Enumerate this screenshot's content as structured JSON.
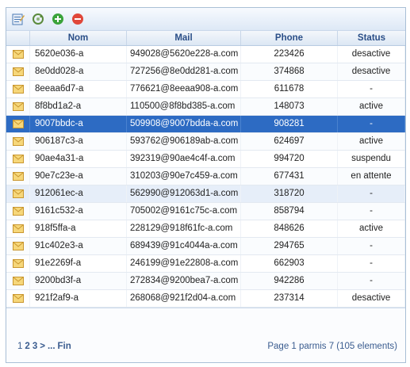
{
  "toolbar": {
    "buttons": [
      {
        "name": "edit-icon",
        "color": "#4b7bb5"
      },
      {
        "name": "refresh-icon",
        "color": "#5a8a3c"
      },
      {
        "name": "add-icon",
        "color": "#3aa33a"
      },
      {
        "name": "delete-icon",
        "color": "#e0473a"
      }
    ]
  },
  "columns": {
    "nom": "Nom",
    "mail": "Mail",
    "phone": "Phone",
    "status": "Status"
  },
  "rows": [
    {
      "nom": "5620e036-a",
      "mail": "949028@5620e228-a.com",
      "phone": "223426",
      "status": "desactive"
    },
    {
      "nom": "8e0dd028-a",
      "mail": "727256@8e0dd281-a.com",
      "phone": "374868",
      "status": "desactive"
    },
    {
      "nom": "8eeaa6d7-a",
      "mail": "776621@8eeaa908-a.com",
      "phone": "611678",
      "status": "-"
    },
    {
      "nom": "8f8bd1a2-a",
      "mail": "110500@8f8bd385-a.com",
      "phone": "148073",
      "status": "active"
    },
    {
      "nom": "9007bbdc-a",
      "mail": "509908@9007bdda-a.com",
      "phone": "908281",
      "status": "-"
    },
    {
      "nom": "906187c3-a",
      "mail": "593762@906189ab-a.com",
      "phone": "624697",
      "status": "active"
    },
    {
      "nom": "90ae4a31-a",
      "mail": "392319@90ae4c4f-a.com",
      "phone": "994720",
      "status": "suspendu"
    },
    {
      "nom": "90e7c23e-a",
      "mail": "310203@90e7c459-a.com",
      "phone": "677431",
      "status": "en attente"
    },
    {
      "nom": "912061ec-a",
      "mail": "562990@912063d1-a.com",
      "phone": "318720",
      "status": "-"
    },
    {
      "nom": "9161c532-a",
      "mail": "705002@9161c75c-a.com",
      "phone": "858794",
      "status": "-"
    },
    {
      "nom": "918f5ffa-a",
      "mail": "228129@918f61fc-a.com",
      "phone": "848626",
      "status": "active"
    },
    {
      "nom": "91c402e3-a",
      "mail": "689439@91c4044a-a.com",
      "phone": "294765",
      "status": "-"
    },
    {
      "nom": "91e2269f-a",
      "mail": "246199@91e22808-a.com",
      "phone": "662903",
      "status": "-"
    },
    {
      "nom": "9200bd3f-a",
      "mail": "272834@9200bea7-a.com",
      "phone": "942286",
      "status": "-"
    },
    {
      "nom": "921f2af9-a",
      "mail": "268068@921f2d04-a.com",
      "phone": "237314",
      "status": "desactive"
    }
  ],
  "selected_row_index": 4,
  "hover_row_index": 8,
  "pager": {
    "pages": [
      "1",
      "2",
      "3",
      ">",
      "...",
      "Fin"
    ],
    "info": "Page 1 parmis 7 (105 elements)"
  },
  "colors": {
    "selected": "#2d6bc3",
    "header_text": "#2a4e87",
    "row_icon": "#f0c75a"
  }
}
